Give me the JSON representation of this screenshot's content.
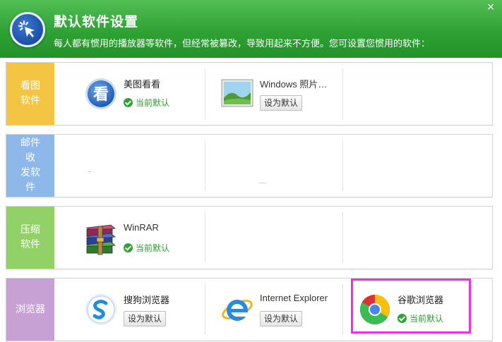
{
  "header": {
    "title": "默认软件设置",
    "description": "每人都有惯用的播放器等软件，但经常被篡改，导致用起来不方便。您可设置您惯用的软件："
  },
  "colors": {
    "header_green": "#2fa234",
    "cat_image": "#f3c542",
    "cat_mail": "#8eb8ea",
    "cat_archive": "#92d068",
    "cat_browser": "#c7a1d3",
    "highlight": "#f22de8"
  },
  "categories": [
    {
      "label": "看图软件",
      "lines": [
        "看图",
        "软件"
      ]
    },
    {
      "label": "邮件收发软件",
      "lines": [
        "邮件收",
        "发软件"
      ]
    },
    {
      "label": "压缩软件",
      "lines": [
        "压缩",
        "软件"
      ]
    },
    {
      "label": "浏览器",
      "lines": [
        "浏览器"
      ]
    }
  ],
  "apps": {
    "meitu": {
      "name": "美图看看",
      "icon": "meitu-kan-icon",
      "status": "当前默认"
    },
    "windows_photo": {
      "name": "Windows 照片…",
      "icon": "windows-photo-icon",
      "action": "设为默认"
    },
    "winrar": {
      "name": "WinRAR",
      "icon": "winrar-icon",
      "status": "当前默认"
    },
    "sogou": {
      "name": "搜狗浏览器",
      "icon": "sogou-browser-icon",
      "action": "设为默认"
    },
    "ie": {
      "name": "Internet Explorer",
      "icon": "internet-explorer-icon",
      "action": "设为默认"
    },
    "chrome": {
      "name": "谷歌浏览器",
      "icon": "chrome-icon",
      "status": "当前默认"
    }
  }
}
